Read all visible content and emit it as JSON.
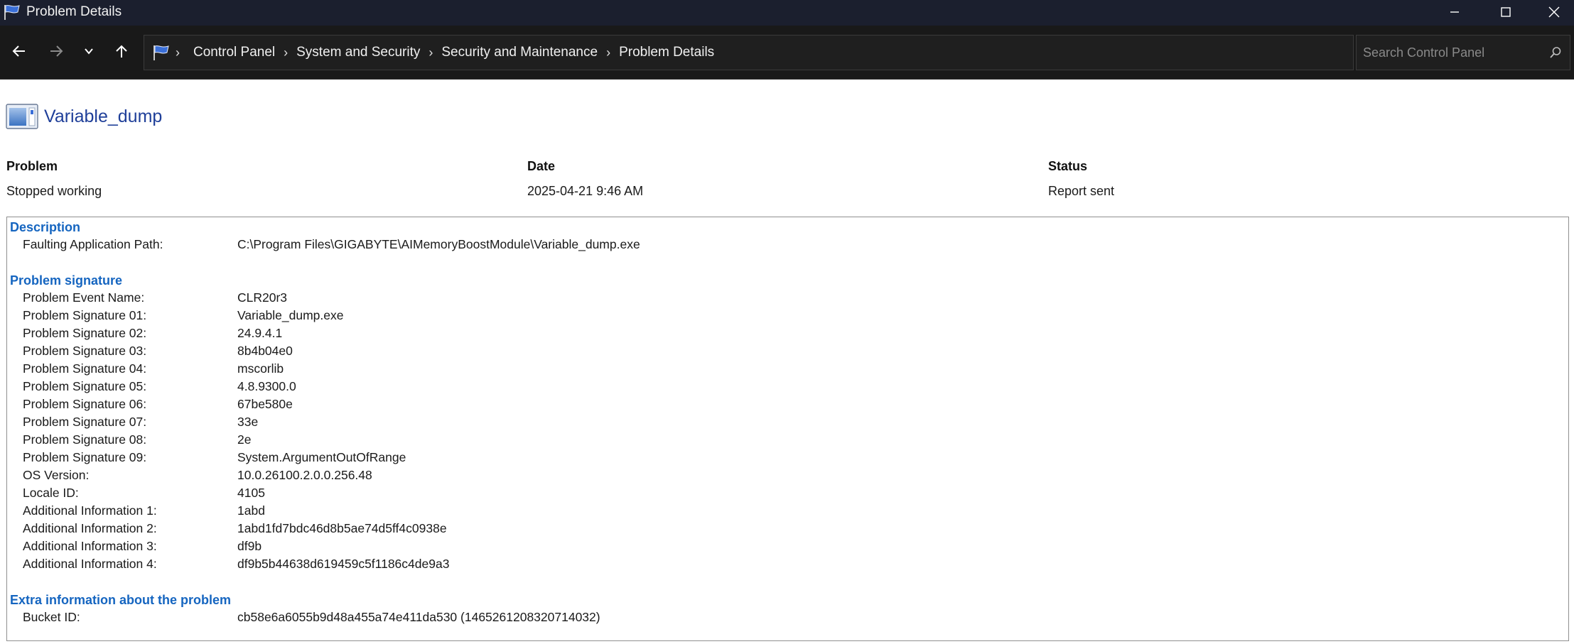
{
  "window": {
    "title": "Problem Details",
    "icon": "flag-icon"
  },
  "navigation": {
    "breadcrumbs": [
      "Control Panel",
      "System and Security",
      "Security and Maintenance",
      "Problem Details"
    ],
    "search_placeholder": "Search Control Panel"
  },
  "page": {
    "title": "Variable_dump",
    "summary": {
      "problem_label": "Problem",
      "problem_value": "Stopped working",
      "date_label": "Date",
      "date_value": "2025-04-21 9:46 AM",
      "status_label": "Status",
      "status_value": "Report sent"
    }
  },
  "details": {
    "description": {
      "title": "Description",
      "rows": [
        {
          "key": "Faulting Application Path:",
          "value": "C:\\Program Files\\GIGABYTE\\AIMemoryBoostModule\\Variable_dump.exe"
        }
      ]
    },
    "signature": {
      "title": "Problem signature",
      "rows": [
        {
          "key": "Problem Event Name:",
          "value": "CLR20r3"
        },
        {
          "key": "Problem Signature 01:",
          "value": "Variable_dump.exe"
        },
        {
          "key": "Problem Signature 02:",
          "value": "24.9.4.1"
        },
        {
          "key": "Problem Signature 03:",
          "value": "8b4b04e0"
        },
        {
          "key": "Problem Signature 04:",
          "value": "mscorlib"
        },
        {
          "key": "Problem Signature 05:",
          "value": "4.8.9300.0"
        },
        {
          "key": "Problem Signature 06:",
          "value": "67be580e"
        },
        {
          "key": "Problem Signature 07:",
          "value": "33e"
        },
        {
          "key": "Problem Signature 08:",
          "value": "2e"
        },
        {
          "key": "Problem Signature 09:",
          "value": "System.ArgumentOutOfRange"
        },
        {
          "key": "OS Version:",
          "value": "10.0.26100.2.0.0.256.48"
        },
        {
          "key": "Locale ID:",
          "value": "4105"
        },
        {
          "key": "Additional Information 1:",
          "value": "1abd"
        },
        {
          "key": "Additional Information 2:",
          "value": "1abd1fd7bdc46d8b5ae74d5ff4c0938e"
        },
        {
          "key": "Additional Information 3:",
          "value": "df9b"
        },
        {
          "key": "Additional Information 4:",
          "value": "df9b5b44638d619459c5f1186c4de9a3"
        }
      ]
    },
    "extra": {
      "title": "Extra information about the problem",
      "rows": [
        {
          "key": "Bucket ID:",
          "value": "cb58e6a6055b9d48a455a74e411da530 (1465261208320714032)"
        }
      ]
    }
  },
  "colors": {
    "titlebar_bg": "#1b1f2e",
    "navbar_bg": "#191919",
    "title_blue": "#1f3f99",
    "section_blue": "#1565c0"
  }
}
